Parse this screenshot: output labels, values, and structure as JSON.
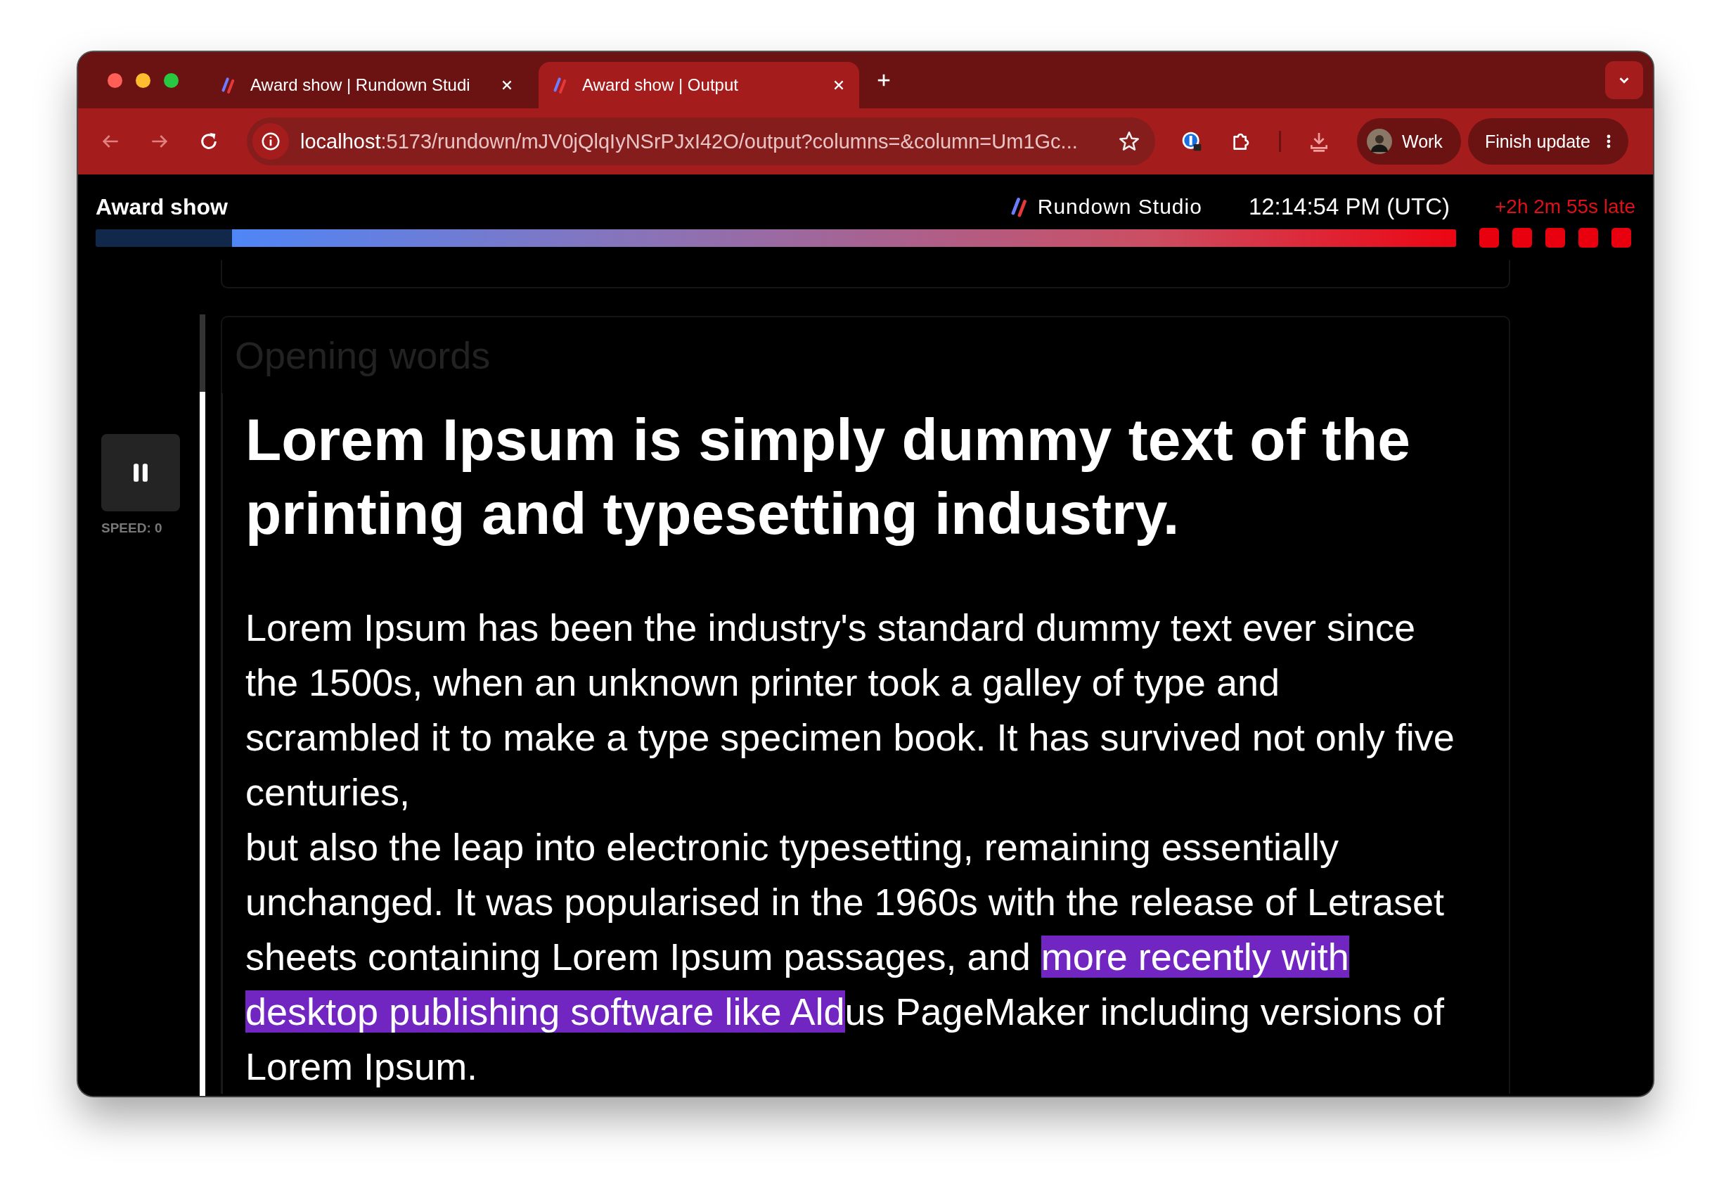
{
  "browser": {
    "tabs": [
      {
        "title": "Award show | Rundown Studi",
        "selected": false
      },
      {
        "title": "Award show | Output",
        "selected": true
      }
    ],
    "address": {
      "host": "localhost",
      "path": ":5173/rundown/mJV0jQlqIyNSrPJxI42O/output?columns=&column=Um1Gc..."
    },
    "profile": {
      "label": "Work"
    },
    "update_button": {
      "label": "Finish update"
    }
  },
  "header": {
    "title": "Award show",
    "brand": "Rundown Studio",
    "clock": "12:14:54 PM (UTC)",
    "late_status": "+2h 2m 55s late",
    "progress": {
      "level": 0.9
    },
    "late_blocks": [
      {
        "on": true
      },
      {
        "on": true
      },
      {
        "on": true
      },
      {
        "on": true
      },
      {
        "on": true
      }
    ]
  },
  "controls": {
    "playing": true,
    "speed": "SPEED: 0"
  },
  "cue": {
    "title": "Opening words",
    "headline": "Lorem Ipsum is simply dummy text of the printing and typesetting industry.",
    "paragraphs": [
      [
        {
          "text": "Lorem Ipsum has been the industry's standard dummy text ever since the 1500s, when an unknown printer took a galley of type and scrambled it to make a type specimen book. It has survived not only five centuries,",
          "highlighted": false
        }
      ],
      [
        {
          "text": "but also the leap into electronic typesetting, remaining essentially unchanged. It was popularised in the 1960s with the release of Letraset sheets containing Lorem Ipsum passages, and ",
          "highlighted": false
        },
        {
          "text": "more recently with desktop publishing software like Ald",
          "highlighted": true
        },
        {
          "text": "us PageMaker including versions of Lorem Ipsum.",
          "highlighted": false
        }
      ]
    ]
  }
}
